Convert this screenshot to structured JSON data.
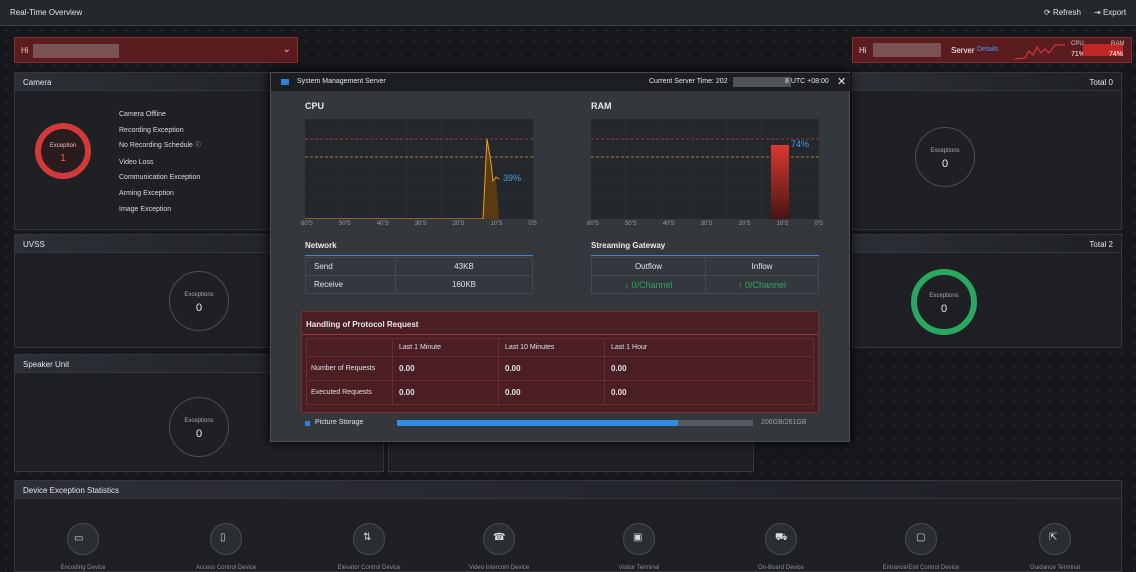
{
  "topbar": {
    "title": "Real-Time Overview",
    "refresh": "Refresh",
    "export": "Export"
  },
  "host_select": {
    "value": "Hi"
  },
  "server": {
    "name_prefix": "Hi",
    "label": "Server",
    "details": "Details",
    "cpu_label": "CPU",
    "cpu_value": "71%",
    "ram_label": "RAM",
    "ram_value": "74%"
  },
  "camera": {
    "title": "Camera",
    "ring_label": "Exception",
    "ring_value": "1",
    "list": [
      "Camera Offline",
      "Recording Exception",
      "No Recording Schedule",
      "Video Loss",
      "Communication Exception",
      "Arming Exception",
      "Image Exception"
    ],
    "right_total": "Total 0",
    "right_label": "Exceptions",
    "right_value": "0"
  },
  "uvss": {
    "title": "UVSS",
    "label": "Exceptions",
    "value": "0",
    "right_total": "Total 2",
    "right_label": "Exceptions",
    "right_value": "0"
  },
  "speaker": {
    "title": "Speaker Unit",
    "label": "Exceptions",
    "value": "0"
  },
  "stats": {
    "title": "Device Exception Statistics",
    "devices": [
      "Encoding Device",
      "Access Control Device",
      "Elevator Control Device",
      "Video Intercom Device",
      "Visitor Terminal",
      "On-Board Device",
      "Entrance/Exit Control Device",
      "Guidance Terminal"
    ]
  },
  "modal": {
    "title": "System Management Server",
    "time_prefix": "Current Server Time: 202",
    "time_suffix": "8 UTC +08:00",
    "cpu": {
      "title": "CPU",
      "value": "39%",
      "x_ticks": [
        "60'S",
        "50'S",
        "40'S",
        "30'S",
        "20'S",
        "10'S",
        "0'S"
      ]
    },
    "ram": {
      "title": "RAM",
      "value": "74%",
      "x_ticks": [
        "60'S",
        "50'S",
        "40'S",
        "30'S",
        "20'S",
        "10'S",
        "0'S"
      ]
    },
    "network": {
      "title": "Network",
      "send_label": "Send",
      "send_value": "43KB",
      "receive_label": "Receive",
      "receive_value": "160KB"
    },
    "gateway": {
      "title": "Streaming Gateway",
      "outflow": "Outflow",
      "inflow": "Inflow",
      "outflow_value": "↓ 0/Channel",
      "inflow_value": "↑ 0/Channel"
    },
    "protocol": {
      "title": "Handling of Protocol Request",
      "cols": [
        "Last 1 Minute",
        "Last 10 Minutes",
        "Last 1 Hour"
      ],
      "rows": [
        {
          "label": "Number of Requests",
          "values": [
            "0.00",
            "0.00",
            "0.00"
          ]
        },
        {
          "label": "Executed Requests",
          "values": [
            "0.00",
            "0.00",
            "0.00"
          ]
        }
      ]
    },
    "storage": {
      "label": "Picture Storage",
      "value": "206GB/261GB",
      "used_fraction": 0.79
    }
  },
  "colors": {
    "accent": "#2f7fd6",
    "danger": "#d23a3a",
    "ok": "#2aa860",
    "warn": "#e8a020"
  }
}
